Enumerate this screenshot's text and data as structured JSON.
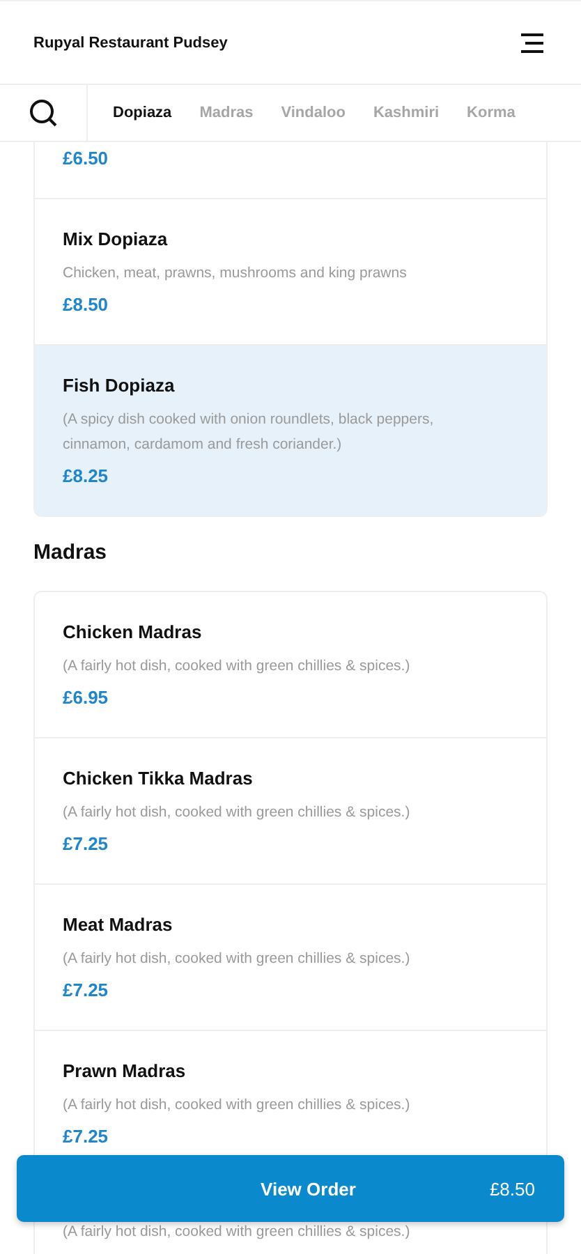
{
  "header": {
    "title": "Rupyal Restaurant Pudsey"
  },
  "tabs": [
    {
      "label": "Dopiaza",
      "selected": true
    },
    {
      "label": "Madras",
      "selected": false
    },
    {
      "label": "Vindaloo",
      "selected": false
    },
    {
      "label": "Kashmiri",
      "selected": false
    },
    {
      "label": "Korma",
      "selected": false
    }
  ],
  "sections": [
    {
      "items": [
        {
          "price": "£6.50",
          "selected": false
        },
        {
          "name": "Mix Dopiaza",
          "description": "Chicken, meat, prawns, mushrooms and king prawns",
          "price": "£8.50",
          "selected": false
        },
        {
          "name": "Fish Dopiaza",
          "description": "(A spicy dish cooked with onion roundlets, black peppers, cinnamon, cardamom and fresh coriander.)",
          "price": "£8.25",
          "selected": true
        }
      ]
    },
    {
      "title": "Madras",
      "items": [
        {
          "name": "Chicken Madras",
          "description": "(A fairly hot dish, cooked with green chillies & spices.)",
          "price": "£6.95",
          "selected": false
        },
        {
          "name": "Chicken Tikka Madras",
          "description": "(A fairly hot dish, cooked with green chillies & spices.)",
          "price": "£7.25",
          "selected": false
        },
        {
          "name": "Meat Madras",
          "description": "(A fairly hot dish, cooked with green chillies & spices.)",
          "price": "£7.25",
          "selected": false
        },
        {
          "name": "Prawn Madras",
          "description": "(A fairly hot dish, cooked with green chillies & spices.)",
          "price": "£7.25",
          "selected": false
        },
        {
          "description": "(A fairly hot dish, cooked with green chillies & spices.)",
          "selected": false
        }
      ]
    }
  ],
  "order_button": {
    "label": "View Order",
    "total": "£8.50"
  }
}
